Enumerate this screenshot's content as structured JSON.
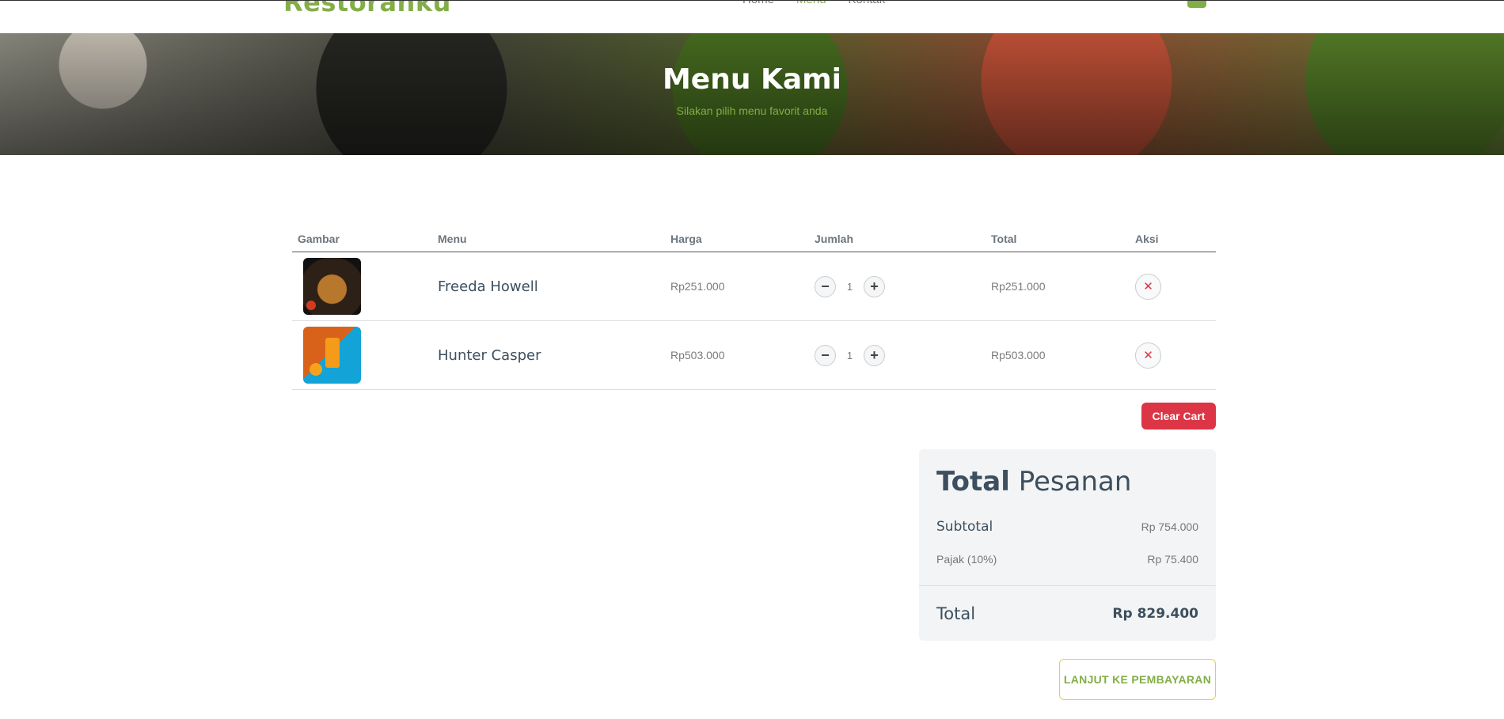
{
  "navbar": {
    "brand": "Restoranku",
    "links": [
      "Home",
      "Menu",
      "Kontak"
    ]
  },
  "hero": {
    "title": "Menu Kami",
    "subtitle": "Silakan pilih menu favorit anda"
  },
  "cart": {
    "headers": [
      "Gambar",
      "Menu",
      "Harga",
      "Jumlah",
      "Total",
      "Aksi"
    ],
    "items": [
      {
        "image": "burger-photo",
        "name": "Freeda Howell",
        "price": "Rp251.000",
        "qty": "1",
        "total": "Rp251.000"
      },
      {
        "image": "orange-juice-photo",
        "name": "Hunter Casper",
        "price": "Rp503.000",
        "qty": "1",
        "total": "Rp503.000"
      }
    ],
    "clear_label": "Clear Cart"
  },
  "summary": {
    "title_bold": "Total",
    "title_rest": "Pesanan",
    "subtotal_label": "Subtotal",
    "subtotal_value": "Rp 754.000",
    "tax_label": "Pajak (10%)",
    "tax_value": "Rp 75.400",
    "total_label": "Total",
    "total_value": "Rp 829.400"
  },
  "checkout_label": "LANJUT KE PEMBAYARAN",
  "colors": {
    "accent": "#82ae46",
    "danger": "#dc3545",
    "border_warn": "#f5c842"
  }
}
